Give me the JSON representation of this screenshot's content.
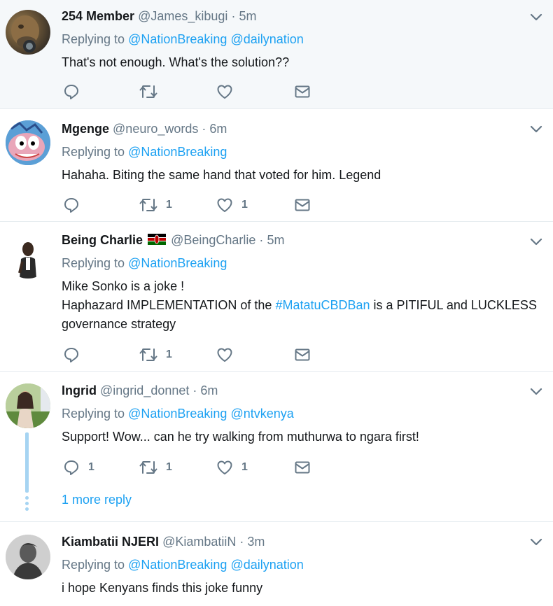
{
  "tweets": [
    {
      "name": "254 Member",
      "handle": "@James_kibugi",
      "time": "5m",
      "replying_prefix": "Replying to",
      "replying_to": [
        "@NationBreaking",
        "@dailynation"
      ],
      "text_lines": [
        "That's not enough. What's the solution??"
      ],
      "counts": {
        "reply": "",
        "retweet": "",
        "like": ""
      }
    },
    {
      "name": "Mgenge",
      "handle": "@neuro_words",
      "time": "6m",
      "replying_prefix": "Replying to",
      "replying_to": [
        "@NationBreaking"
      ],
      "text_lines": [
        "Hahaha. Biting the same hand that voted for him. Legend"
      ],
      "counts": {
        "reply": "",
        "retweet": "1",
        "like": "1"
      }
    },
    {
      "name": "Being Charlie",
      "handle": "@BeingCharlie",
      "time": "5m",
      "replying_prefix": "Replying to",
      "replying_to": [
        "@NationBreaking"
      ],
      "text_line1": "Mike Sonko is a joke !",
      "text_line2_pre": "Haphazard IMPLEMENTATION of the ",
      "text_line2_hashtag": "#MatatuCBDBan",
      "text_line2_post": " is a PITIFUL and LUCKLESS",
      "text_line3": "governance strategy",
      "counts": {
        "reply": "",
        "retweet": "1",
        "like": ""
      }
    },
    {
      "name": "Ingrid",
      "handle": "@ingrid_donnet",
      "time": "6m",
      "replying_prefix": "Replying to",
      "replying_to": [
        "@NationBreaking",
        "@ntvkenya"
      ],
      "text_lines": [
        "Support! Wow... can he try walking from muthurwa to ngara first!"
      ],
      "counts": {
        "reply": "1",
        "retweet": "1",
        "like": "1"
      }
    },
    {
      "name": "Kiambatii NJERI",
      "handle": "@KiambatiiN",
      "time": "3m",
      "replying_prefix": "Replying to",
      "replying_to": [
        "@NationBreaking",
        "@dailynation"
      ],
      "text_lines": [
        "i hope Kenyans finds this joke funny"
      ],
      "counts": {
        "reply": "",
        "retweet": "",
        "like": ""
      }
    }
  ],
  "more_reply": "1 more reply",
  "dot": "·",
  "colors": {
    "accent": "#1da1f2",
    "muted": "#657786",
    "thread": "#a6d4f2",
    "highlight_bg": "#f5f8fa"
  },
  "icons": [
    "reply-icon",
    "retweet-icon",
    "like-icon",
    "direct-message-icon",
    "chevron-down-icon",
    "kenya-flag-icon"
  ]
}
